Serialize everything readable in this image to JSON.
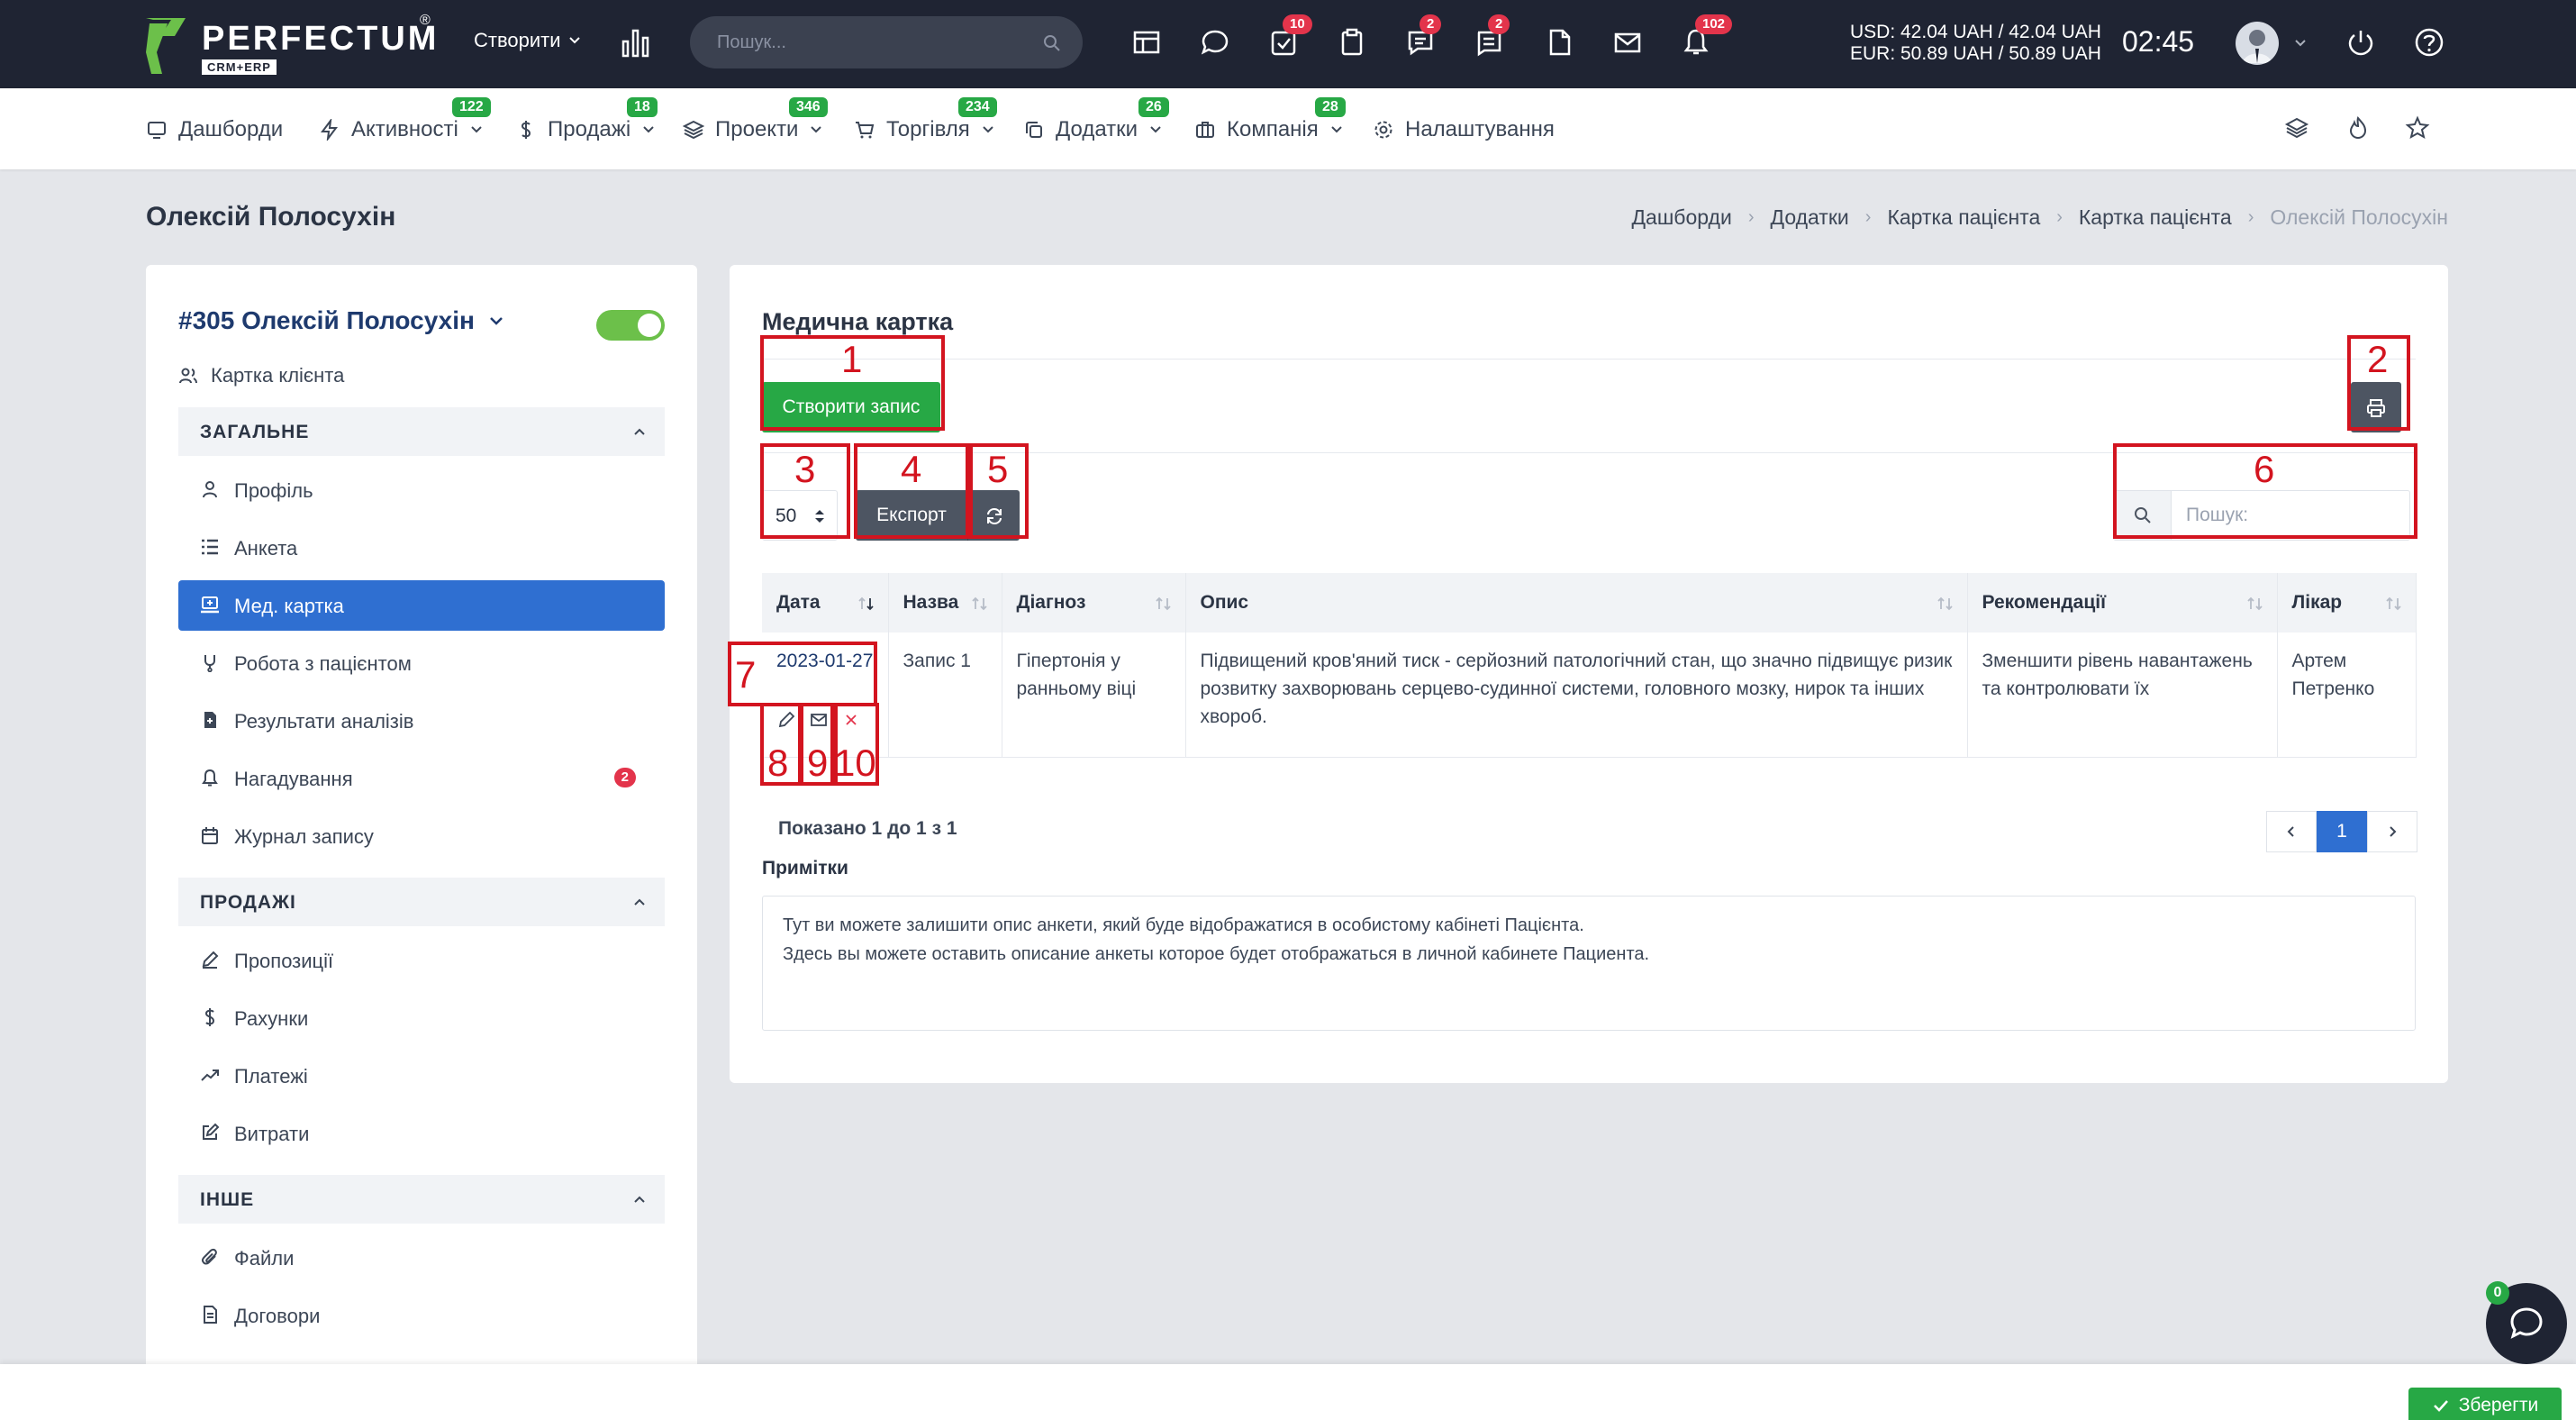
{
  "app": {
    "brand": "PERFECTUM",
    "brand_reg": "®",
    "brand_sub": "CRM+ERP"
  },
  "topbar": {
    "create_label": "Створити",
    "search_placeholder": "Пошук...",
    "badges": {
      "tasks": "10",
      "chat": "2",
      "messages": "2",
      "notifications": "102"
    },
    "rate_usd": "USD: 42.04 UAH / 42.04 UAH",
    "rate_eur": "EUR: 50.89 UAH / 50.89 UAH",
    "time": "02:45"
  },
  "menu": {
    "dashboards": "Дашборди",
    "activities": "Активності",
    "activities_badge": "122",
    "sales": "Продажі",
    "sales_badge": "18",
    "projects": "Проекти",
    "projects_badge": "346",
    "trade": "Торгівля",
    "trade_badge": "234",
    "addons": "Додатки",
    "addons_badge": "26",
    "company": "Компанія",
    "company_badge": "28",
    "settings": "Налаштування"
  },
  "page": {
    "title": "Олексій Полосухін",
    "breadcrumb": [
      "Дашборди",
      "Додатки",
      "Картка пацієнта",
      "Картка пацієнта",
      "Олексій Полосухін"
    ]
  },
  "sidebar": {
    "client_title": "#305 Олексій Полосухін",
    "client_card_link": "Картка клієнта",
    "sections": {
      "general": "ЗАГАЛЬНЕ",
      "sales": "ПРОДАЖІ",
      "other": "ІНШЕ"
    },
    "items": {
      "profile": "Профіль",
      "questionnaire": "Анкета",
      "med_card": "Мед. картка",
      "patient_work": "Робота з пацієнтом",
      "analysis_results": "Результати аналізів",
      "reminders": "Нагадування",
      "reminders_badge": "2",
      "record_log": "Журнал запису",
      "proposals": "Пропозиції",
      "invoices": "Рахунки",
      "payments": "Платежі",
      "expenses": "Витрати",
      "files": "Файли",
      "contracts": "Договори"
    }
  },
  "medcard": {
    "title": "Медична картка",
    "create_label": "Створити запис",
    "page_length": "50",
    "export_label": "Експорт",
    "search_placeholder": "Пошук:",
    "columns": [
      "Дата",
      "Назва",
      "Діагноз",
      "Опис",
      "Рекомендації",
      "Лікар"
    ],
    "rows": [
      {
        "date": "2023-01-27",
        "name": "Запис 1",
        "diagnosis": "Гіпертонія у ранньому віці",
        "description": "Підвищений кров'яний тиск - серйозний патологічний стан, що значно підвищує ризик розвитку захворювань серцево-судинної системи, головного мозку, нирок та інших хвороб.",
        "recommendations": "Зменшити рівень навантажень та контролювати їх",
        "doctor": "Артем Петренко"
      }
    ],
    "shown_text": "Показано 1 до 1 з 1",
    "current_page": "1",
    "notes_label": "Примітки",
    "notes_line1": "Тут ви можете залишити опис анкети, який буде відображатися в особистому кабінеті Пацієнта.",
    "notes_line2": "Здесь вы можете оставить описание анкеты которое будет отображаться в личной кабинете Пациента."
  },
  "annotations": [
    "1",
    "2",
    "3",
    "4",
    "5",
    "6",
    "7",
    "8",
    "9",
    "10"
  ],
  "footer": {
    "save_label": "Зберегти",
    "chat_badge": "0"
  },
  "colors": {
    "topbar": "#1f2433",
    "accent_blue": "#2f6fd1",
    "green": "#27a845",
    "badge_red": "#e3344b",
    "marker_red": "#d3141f"
  }
}
